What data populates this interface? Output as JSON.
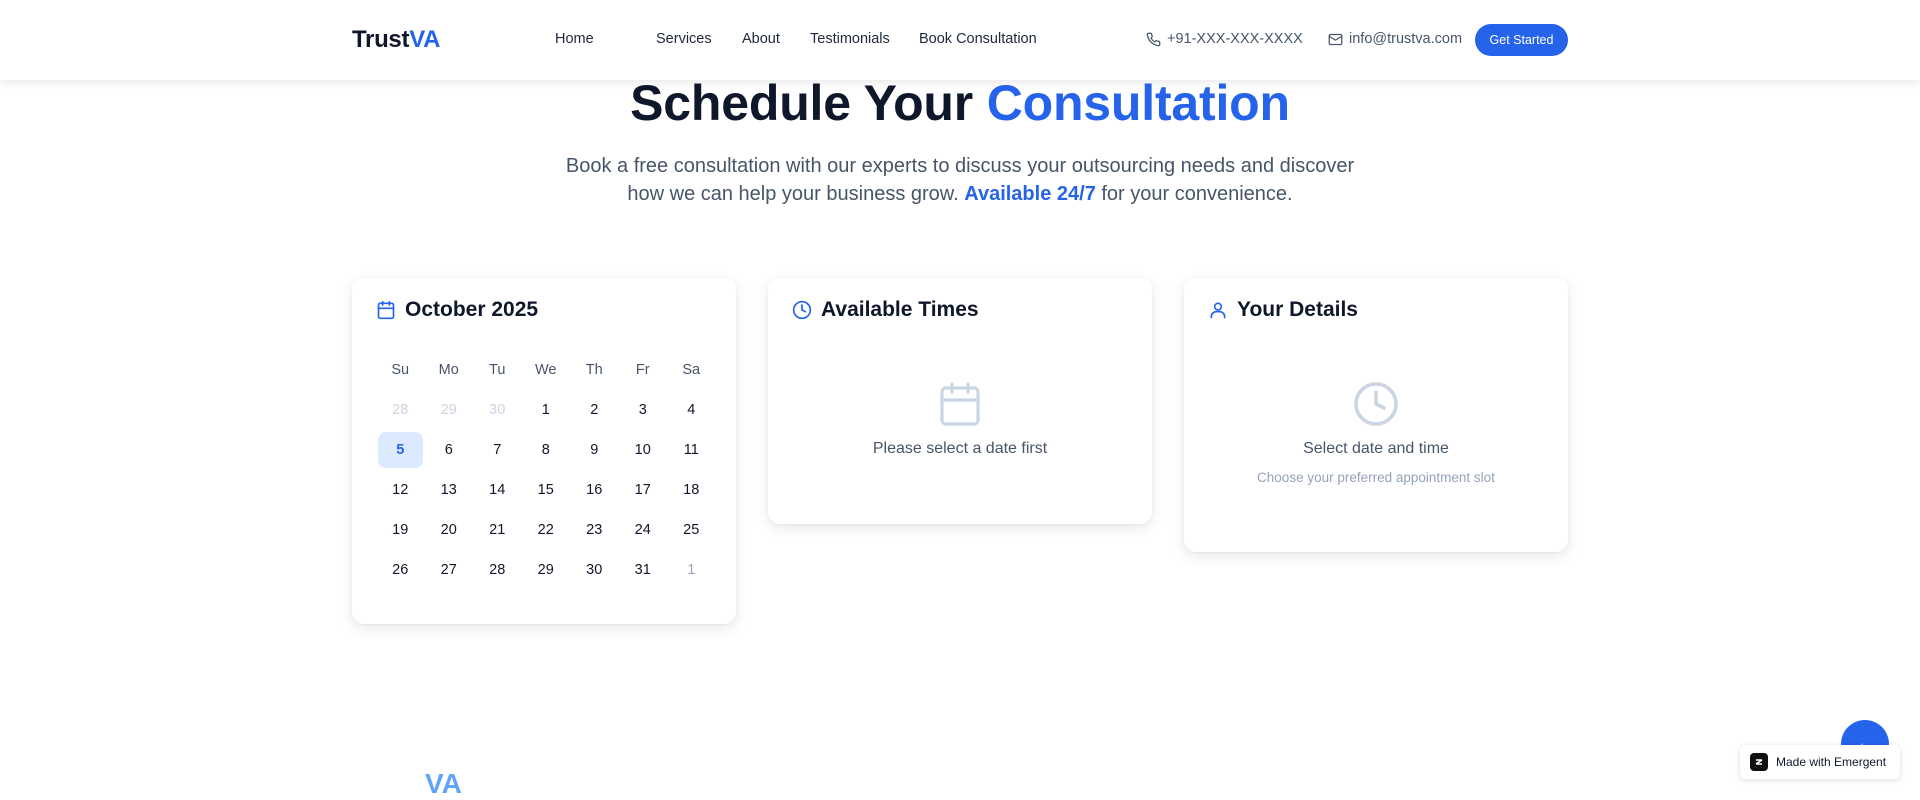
{
  "nav": {
    "brand": {
      "main": "Trust",
      "accent": "VA"
    },
    "links": [
      "Home",
      "Services",
      "About",
      "Testimonials",
      "Book Consultation"
    ],
    "phone": "+91-XXX-XXX-XXXX",
    "email": "info@trustva.com",
    "cta": "Get Started"
  },
  "hero": {
    "title_main": "Schedule Your",
    "title_accent": "Consultation",
    "sub_before": "Book a free consultation with our experts to discuss your outsourcing needs and discover how we can help your business grow.",
    "sub_highlight": "Available 24/7",
    "sub_after": "for your convenience."
  },
  "calendar": {
    "month": "October 2025",
    "weekdays": [
      "Su",
      "Mo",
      "Tu",
      "We",
      "Th",
      "Fr",
      "Sa"
    ],
    "selected_day": 5,
    "weeks": [
      [
        "28",
        "29",
        "30",
        "1",
        "2",
        "3",
        "4"
      ],
      [
        "5",
        "6",
        "7",
        "8",
        "9",
        "10",
        "11"
      ],
      [
        "12",
        "13",
        "14",
        "15",
        "16",
        "17",
        "18"
      ],
      [
        "19",
        "20",
        "21",
        "22",
        "23",
        "24",
        "25"
      ],
      [
        "26",
        "27",
        "28",
        "29",
        "30",
        "31",
        "1"
      ]
    ]
  },
  "times": {
    "title": "Available Times",
    "empty": "Please select a date first"
  },
  "details": {
    "title": "Your Details",
    "empty_title": "Select date and time",
    "empty_sub": "Choose your preferred appointment slot"
  },
  "footer": {
    "brand_peek": "VA"
  },
  "badge": {
    "text": "Made with Emergent"
  },
  "colors": {
    "accent": "#2563eb",
    "text": "#0f172a",
    "muted": "#475569",
    "selected_bg": "#dbeafe"
  },
  "icons": {
    "phone": "phone-icon",
    "email": "mail-icon",
    "calendar": "calendar-icon",
    "clock": "clock-icon",
    "user": "user-icon",
    "scroll_top": "arrow-icon",
    "badge": "emergent-logo-icon"
  }
}
